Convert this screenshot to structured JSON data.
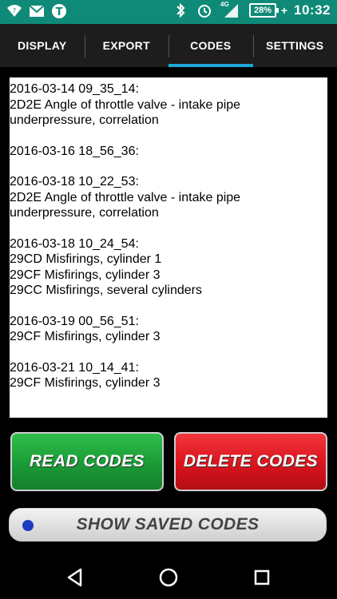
{
  "status_bar": {
    "time": "10:32",
    "battery_percent": "28%",
    "network_label": "4G",
    "icons": [
      "wifi-question-icon",
      "mail-icon",
      "tasker-t-icon",
      "bluetooth-icon",
      "alarm-icon",
      "signal-icon",
      "battery-icon"
    ]
  },
  "tabs": [
    {
      "label": "DISPLAY"
    },
    {
      "label": "EXPORT"
    },
    {
      "label": "CODES"
    },
    {
      "label": "SETTINGS"
    }
  ],
  "active_tab": "CODES",
  "log": {
    "entries": [
      {
        "lines": [
          "2016-03-14 09_35_14:",
          "2D2E Angle of throttle valve - intake pipe",
          "underpressure, correlation"
        ]
      },
      {
        "lines": [
          "2016-03-16 18_56_36:"
        ]
      },
      {
        "lines": [
          "2016-03-18 10_22_53:",
          "2D2E Angle of throttle valve - intake pipe",
          "underpressure, correlation"
        ]
      },
      {
        "lines": [
          "2016-03-18 10_24_54:",
          "29CD Misfirings, cylinder 1",
          "29CF Misfirings, cylinder 3",
          "29CC Misfirings, several cylinders"
        ]
      },
      {
        "lines": [
          "2016-03-19 00_56_51:",
          "29CF Misfirings, cylinder 3"
        ]
      },
      {
        "lines": [
          "2016-03-21 10_14_41:",
          "29CF Misfirings, cylinder 3"
        ]
      }
    ]
  },
  "buttons": {
    "read_label": "READ CODES",
    "delete_label": "DELETE CODES",
    "saved_label": "SHOW SAVED CODES"
  },
  "colors": {
    "status_bar": "#0f8a78",
    "tab_indicator": "#1ea7d8",
    "read_button": "#1fa93c",
    "delete_button": "#e01a22"
  }
}
